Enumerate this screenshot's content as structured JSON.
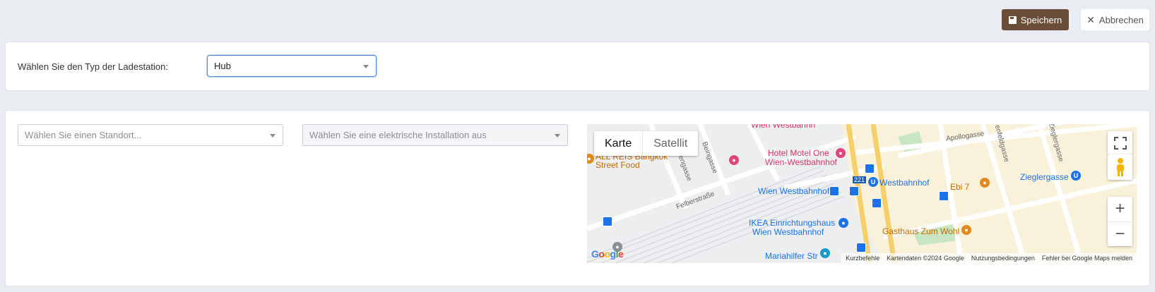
{
  "toolbar": {
    "save_label": "Speichern",
    "cancel_label": "Abbrechen"
  },
  "type_section": {
    "label": "Wählen Sie den Typ der Ladestation:",
    "selected_value": "Hub"
  },
  "location_section": {
    "location_placeholder": "Wählen Sie einen Standort...",
    "installation_placeholder": "Wählen Sie eine elektrische Installation aus"
  },
  "map": {
    "tab_map": "Karte",
    "tab_satellite": "Satellit",
    "labels": {
      "restaurant_thai": "ALL REIS Bangkok",
      "restaurant_thai_2": "Street Food",
      "hotel_name": "Hotel Motel One",
      "hotel_name_2": "Wien-Westbahnhof",
      "station": "Wien Westbahnhof",
      "ubahn": "Westbahnhof",
      "ebi": "Ebi 7",
      "zieglergasse": "Zieglergasse",
      "ikea": "IKEA Einrichtungshaus",
      "ikea_2": "Wien Westbahnhof",
      "gasthaus": "Gasthaus Zum Wohl",
      "mariahilfer": "Mariahilfer Str",
      "street_felber": "Felberstraße",
      "street_beingasse": "Beingasse",
      "street_apollogasse": "Apollogasse",
      "street_nnengasse": "nnengasse",
      "street_enfeldgasse": "enfeldgasse",
      "street_zieglergasse": "Zieglergasse",
      "road_number": "221",
      "wien_westbahn_top": "Wien Westbahnh"
    },
    "google_logo": "Google",
    "attribution": {
      "shortcuts": "Kurzbefehle",
      "map_data": "Kartendaten ©2024 Google",
      "terms": "Nutzungsbedingungen",
      "report": "Fehler bei Google Maps melden"
    },
    "zoom_in": "+",
    "zoom_out": "−"
  },
  "colors": {
    "save_button": "#6b4e3a",
    "focus_border": "#4a90d9",
    "page_background": "#e9ecf1"
  },
  "icons": {
    "save": "floppy-disk-icon",
    "cancel": "close-icon",
    "fullscreen": "fullscreen-icon",
    "pegman": "street-view-pegman-icon"
  }
}
